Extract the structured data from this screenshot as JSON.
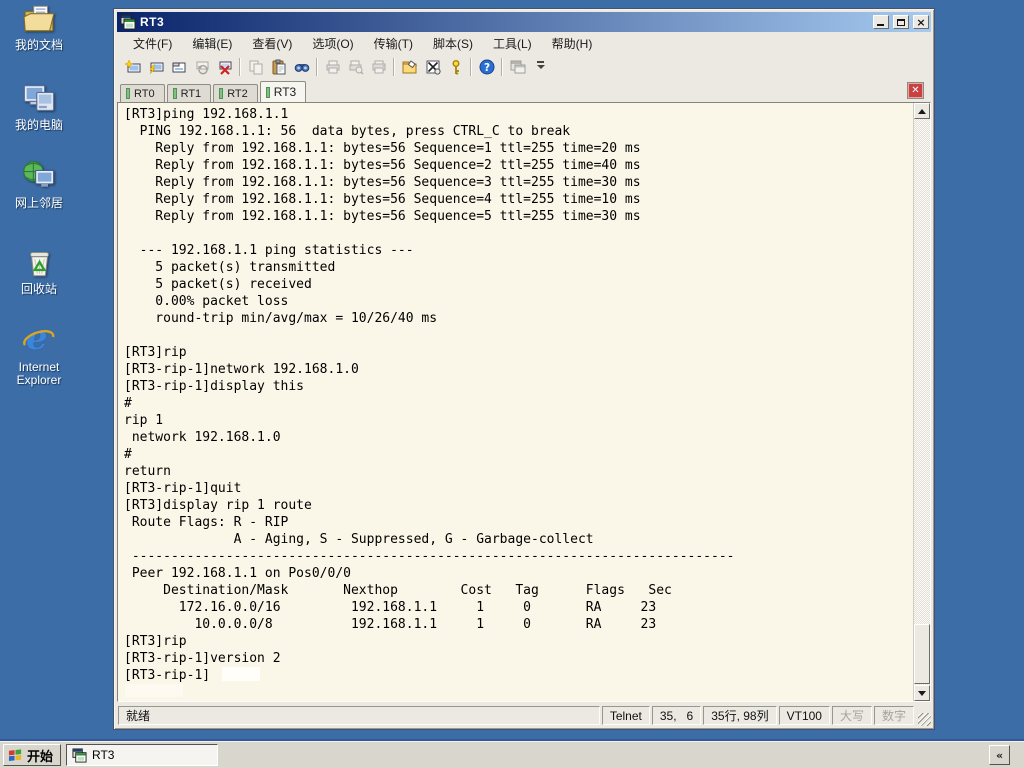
{
  "colors": {
    "desktop": "#3d6da6",
    "titlebar_left": "#0a246a",
    "titlebar_right": "#a6caf0",
    "chrome": "#ece9e2",
    "terminal_bg": "#fbf7e8",
    "tab_indicator": "#7cc47c",
    "close_red": "#c94141"
  },
  "desktop": {
    "icons": [
      {
        "name": "my-documents",
        "label": "我的文档"
      },
      {
        "name": "my-computer",
        "label": "我的电脑"
      },
      {
        "name": "network-places",
        "label": "网上邻居"
      },
      {
        "name": "recycle-bin",
        "label": "回收站"
      },
      {
        "name": "internet-explorer",
        "label": "Internet Explorer"
      }
    ]
  },
  "window": {
    "title": "RT3",
    "controls": {
      "minimize": "最小化",
      "maximize": "最大化",
      "close": "×"
    },
    "menu": {
      "file": "文件(F)",
      "edit": "编辑(E)",
      "view": "查看(V)",
      "options": "选项(O)",
      "transfer": "传输(T)",
      "script": "脚本(S)",
      "tools": "工具(L)",
      "help": "帮助(H)"
    },
    "toolbar": {
      "icons": [
        "quick-connect",
        "connect",
        "connect-in-tab",
        "reconnect",
        "disconnect",
        "copy",
        "paste",
        "find",
        "print",
        "print-preview",
        "print-setup",
        "session-options",
        "keymap-options",
        "key-agent",
        "help",
        "app-window",
        "toolbar-overflow"
      ]
    },
    "tabs": [
      {
        "label": "RT0",
        "active": false
      },
      {
        "label": "RT1",
        "active": false
      },
      {
        "label": "RT2",
        "active": false
      },
      {
        "label": "RT3",
        "active": true
      }
    ],
    "tab_close_glyph": "✕",
    "terminal": {
      "lines": [
        "[RT3]ping 192.168.1.1",
        "  PING 192.168.1.1: 56  data bytes, press CTRL_C to break",
        "    Reply from 192.168.1.1: bytes=56 Sequence=1 ttl=255 time=20 ms",
        "    Reply from 192.168.1.1: bytes=56 Sequence=2 ttl=255 time=40 ms",
        "    Reply from 192.168.1.1: bytes=56 Sequence=3 ttl=255 time=30 ms",
        "    Reply from 192.168.1.1: bytes=56 Sequence=4 ttl=255 time=10 ms",
        "    Reply from 192.168.1.1: bytes=56 Sequence=5 ttl=255 time=30 ms",
        "",
        "  --- 192.168.1.1 ping statistics ---",
        "    5 packet(s) transmitted",
        "    5 packet(s) received",
        "    0.00% packet loss",
        "    round-trip min/avg/max = 10/26/40 ms",
        "",
        "[RT3]rip",
        "[RT3-rip-1]network 192.168.1.0",
        "[RT3-rip-1]display this",
        "#",
        "rip 1",
        " network 192.168.1.0",
        "#",
        "return",
        "[RT3-rip-1]quit",
        "[RT3]display rip 1 route",
        " Route Flags: R - RIP",
        "              A - Aging, S - Suppressed, G - Garbage-collect",
        " -----------------------------------------------------------------------------",
        " Peer 192.168.1.1 on Pos0/0/0",
        "     Destination/Mask       Nexthop        Cost   Tag      Flags   Sec",
        "       172.16.0.0/16         192.168.1.1     1     0       RA     23",
        "         10.0.0.0/8          192.168.1.1     1     0       RA     23",
        "[RT3]rip",
        "[RT3-rip-1]version 2",
        "[RT3-rip-1]"
      ]
    },
    "statusbar": {
      "ready": "就绪",
      "protocol": "Telnet",
      "cursor_pos": "35,   6",
      "screen_size": "35行, 98列",
      "emulation": "VT100",
      "caps": "大写",
      "num": "数字"
    }
  },
  "taskbar": {
    "start": "开始",
    "task": "RT3",
    "tray_toggle": "«"
  }
}
